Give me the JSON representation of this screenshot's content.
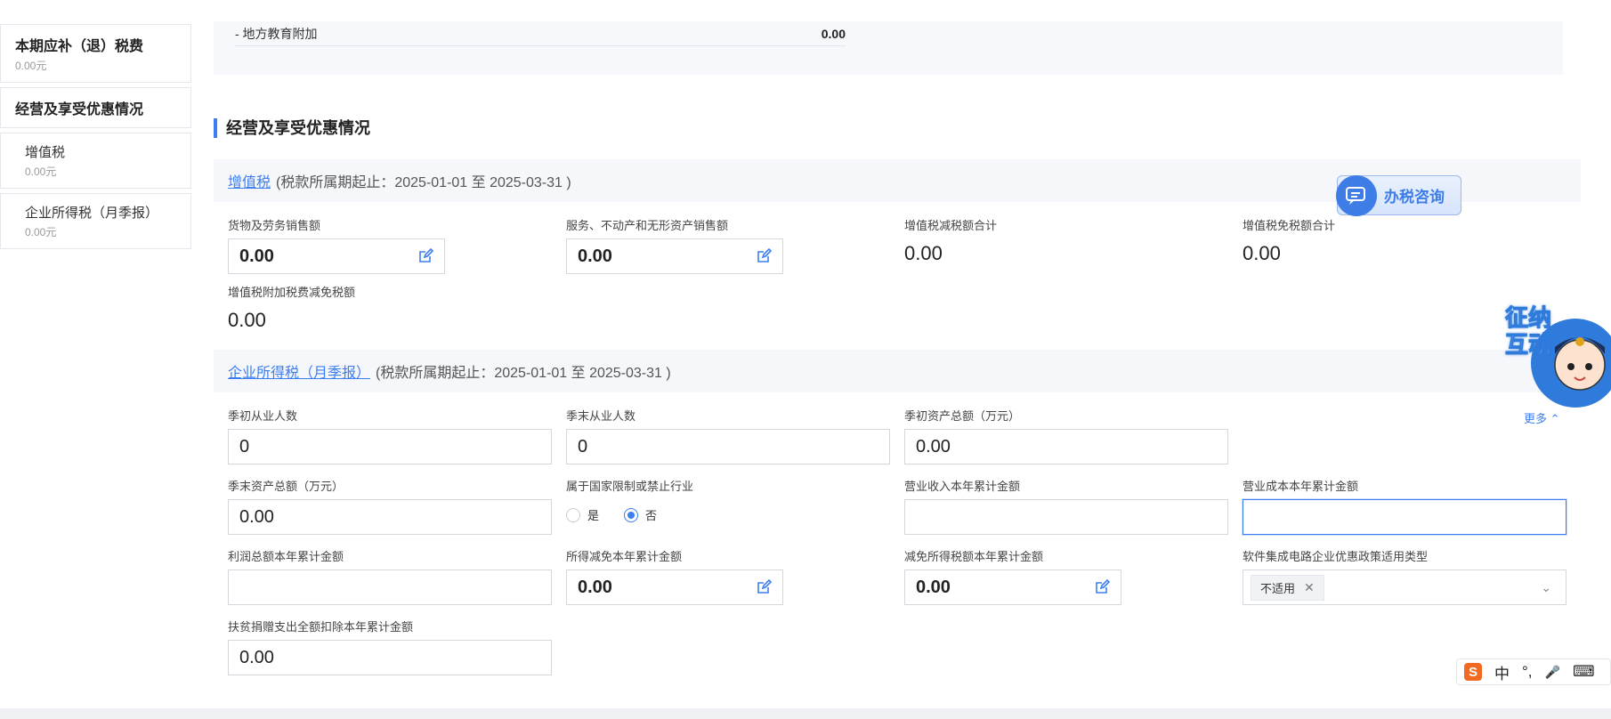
{
  "sidebar": {
    "items": [
      {
        "title": "本期应补（退）税费",
        "amount": "0.00元"
      },
      {
        "title": "经营及享受优惠情况",
        "amount": ""
      },
      {
        "title": "增值税",
        "amount": "0.00元"
      },
      {
        "title": "企业所得税（月季报）",
        "amount": "0.00元"
      }
    ]
  },
  "top_row": {
    "label": "- 地方教育附加",
    "value": "0.00"
  },
  "section": {
    "title": "经营及享受优惠情况"
  },
  "vat": {
    "link": "增值税",
    "period": "(税款所属期起止：2025-01-01 至 2025-03-31 )",
    "fields": {
      "goods_sales": {
        "label": "货物及劳务销售额",
        "value": "0.00"
      },
      "service_sales": {
        "label": "服务、不动产和无形资产销售额",
        "value": "0.00"
      },
      "reduction_total": {
        "label": "增值税减税额合计",
        "value": "0.00"
      },
      "exemption_total": {
        "label": "增值税免税额合计",
        "value": "0.00"
      },
      "surcharge_reduction": {
        "label": "增值税附加税费减免税额",
        "value": "0.00"
      }
    }
  },
  "cit": {
    "link": "企业所得税（月季报）",
    "period": "(税款所属期起止：2025-01-01 至 2025-03-31 )",
    "fields": {
      "start_employees": {
        "label": "季初从业人数",
        "value": "0"
      },
      "end_employees": {
        "label": "季末从业人数",
        "value": "0"
      },
      "start_assets": {
        "label": "季初资产总额（万元）",
        "value": "0.00"
      },
      "end_assets": {
        "label": "季末资产总额（万元）",
        "value": "0.00"
      },
      "restricted": {
        "label": "属于国家限制或禁止行业",
        "options": [
          "是",
          "否"
        ],
        "selected": "否"
      },
      "revenue_ytd": {
        "label": "营业收入本年累计金额",
        "value": ""
      },
      "cost_ytd": {
        "label": "营业成本本年累计金额",
        "value": ""
      },
      "profit_ytd": {
        "label": "利润总额本年累计金额",
        "value": ""
      },
      "income_reduction_ytd": {
        "label": "所得减免本年累计金额",
        "value": "0.00"
      },
      "tax_reduction_ytd": {
        "label": "减免所得税额本年累计金额",
        "value": "0.00"
      },
      "software_policy": {
        "label": "软件集成电路企业优惠政策适用类型",
        "value": "不适用"
      },
      "poverty_donation": {
        "label": "扶贫捐赠支出全额扣除本年累计金额",
        "value": "0.00"
      }
    }
  },
  "consult": {
    "label": "办税咨询"
  },
  "mascot": {
    "text": "征纳互动"
  },
  "more": {
    "label": "更多 ⌃"
  },
  "ime": {
    "s": "S",
    "cn": "中",
    "punct": "°,",
    "mic": "🎤",
    "kbd": "⌨"
  }
}
